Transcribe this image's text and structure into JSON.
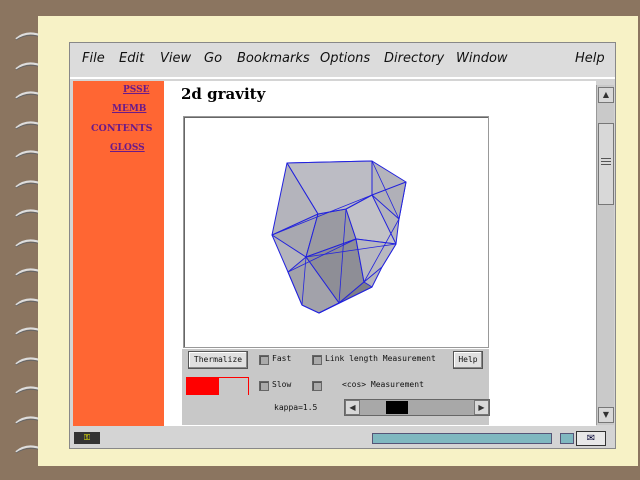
{
  "menu": [
    "File",
    "Edit",
    "View",
    "Go",
    "Bookmarks",
    "Options",
    "Directory",
    "Window",
    "Help"
  ],
  "sidebar": {
    "links": [
      "PSSE",
      "MEMB"
    ],
    "contents": "CONTENTS",
    "gloss": "GLOSS"
  },
  "page_title": "2d gravity",
  "controls": {
    "thermalize": "Thermalize",
    "fast": "Fast",
    "slow": "Slow",
    "link_length": "Link length Measurement",
    "cos": "<cos> Measurement",
    "help": "Help",
    "kappa": "kappa=1.5"
  },
  "colors": {
    "sidebar": "#ff6633",
    "mesh_line": "#2222dd",
    "progress_fill": "#ff0000"
  }
}
